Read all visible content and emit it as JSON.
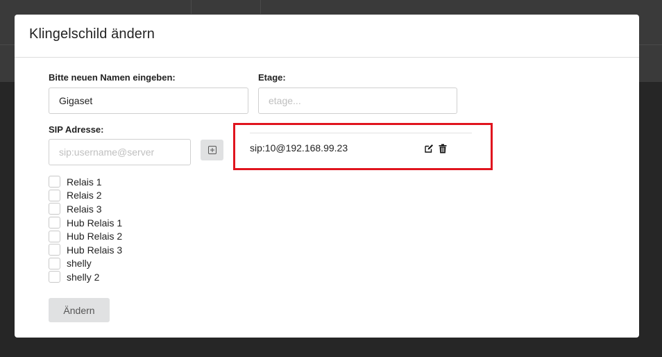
{
  "dialog": {
    "title": "Klingelschild ändern"
  },
  "form": {
    "name_label": "Bitte neuen Namen eingeben:",
    "name_value": "Gigaset",
    "floor_label": "Etage:",
    "floor_placeholder": "etage...",
    "sip_label": "SIP Adresse:",
    "sip_placeholder": "sip:username@server",
    "add_icon": "plus-square-icon"
  },
  "sip_entries": [
    {
      "address": "sip:10@192.168.99.23",
      "edit_icon": "edit-icon",
      "delete_icon": "trash-icon"
    }
  ],
  "relays": [
    {
      "label": "Relais 1",
      "checked": false
    },
    {
      "label": "Relais 2",
      "checked": false
    },
    {
      "label": "Relais 3",
      "checked": false
    },
    {
      "label": "Hub Relais 1",
      "checked": false
    },
    {
      "label": "Hub Relais 2",
      "checked": false
    },
    {
      "label": "Hub Relais 3",
      "checked": false
    },
    {
      "label": "shelly",
      "checked": false
    },
    {
      "label": "shelly 2",
      "checked": false
    }
  ],
  "actions": {
    "submit_label": "Ändern"
  },
  "colors": {
    "highlight_border": "#e0141e",
    "button_bg": "#e0e1e2",
    "overlay": "#2b2b2b"
  }
}
